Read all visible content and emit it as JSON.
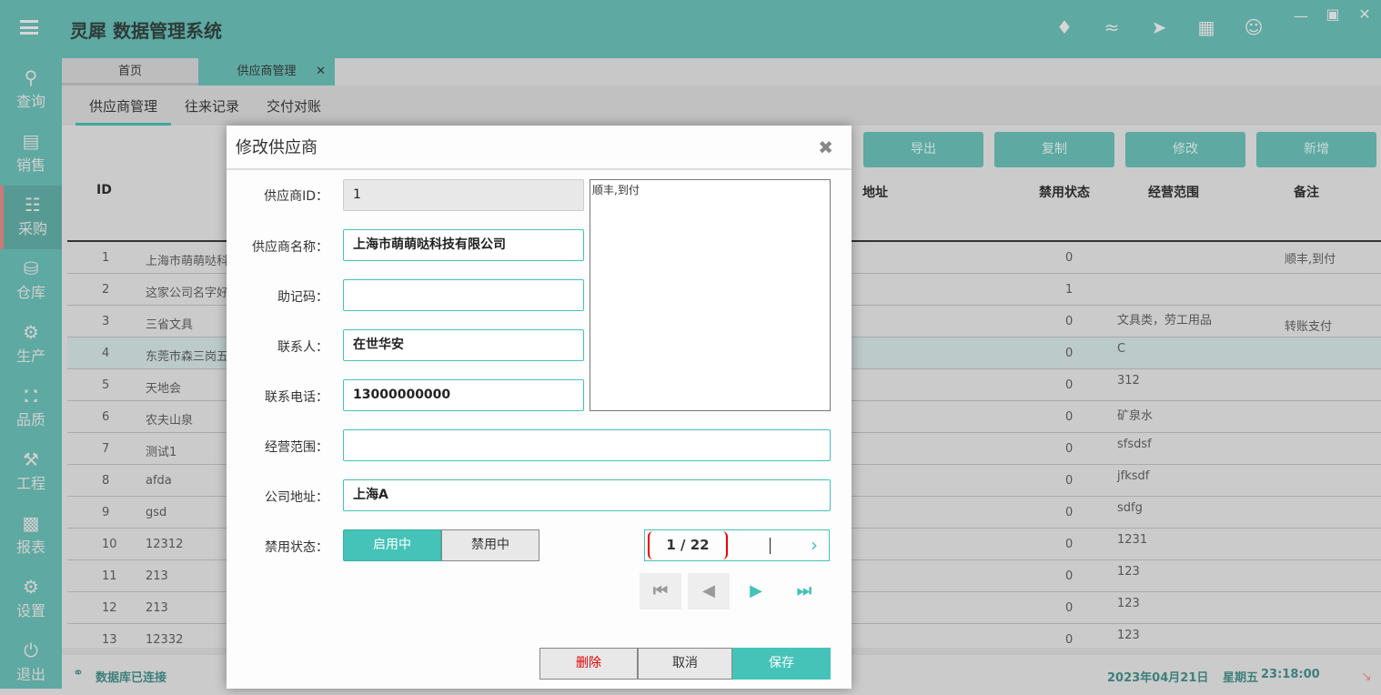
{
  "app": {
    "title": "灵犀 数据管理系统"
  },
  "header_icons": [
    "tag-icon",
    "wifi-icon",
    "send-icon",
    "calculator-icon",
    "user-icon",
    "minimize-icon",
    "maximize-icon",
    "close-icon"
  ],
  "sidebar": {
    "items": [
      {
        "label": "查询",
        "icon": "search-icon"
      },
      {
        "label": "销售",
        "icon": "document-icon"
      },
      {
        "label": "采购",
        "icon": "cart-icon",
        "active": true
      },
      {
        "label": "仓库",
        "icon": "database-icon"
      },
      {
        "label": "生产",
        "icon": "gears-icon"
      },
      {
        "label": "品质",
        "icon": "shield-icon"
      },
      {
        "label": "工程",
        "icon": "wrench-icon"
      },
      {
        "label": "报表",
        "icon": "bar-chart-icon"
      },
      {
        "label": "设置",
        "icon": "gear-icon"
      },
      {
        "label": "退出",
        "icon": "power-icon"
      }
    ]
  },
  "tabs": [
    {
      "label": "首页"
    },
    {
      "label": "供应商管理",
      "active": true
    }
  ],
  "subtabs": [
    {
      "label": "供应商管理"
    },
    {
      "label": "往来记录"
    },
    {
      "label": "交付对账"
    }
  ],
  "toolbar": {
    "export": "导出",
    "copy": "复制",
    "edit": "修改",
    "add": "新增"
  },
  "table": {
    "headers": {
      "id": "ID",
      "address": "地址",
      "status": "禁用状态",
      "scope": "经营范围",
      "remark": "备注"
    },
    "rows": [
      {
        "id": "1",
        "name": "上海市萌萌哒科",
        "status": "0",
        "scope": "",
        "remark": "顺丰,到付"
      },
      {
        "id": "2",
        "name": "这家公司名字好",
        "status": "1",
        "scope": "",
        "remark": ""
      },
      {
        "id": "3",
        "name": "三省文具",
        "status": "0",
        "scope": "文具类，劳工用品",
        "remark": "转账支付"
      },
      {
        "id": "4",
        "name": "东莞市森三岗五",
        "status": "0",
        "scope": "C",
        "remark": ""
      },
      {
        "id": "5",
        "name": "天地会",
        "status": "0",
        "scope": "312",
        "remark": ""
      },
      {
        "id": "6",
        "name": "农夫山泉",
        "status": "0",
        "scope": "矿泉水",
        "remark": ""
      },
      {
        "id": "7",
        "name": "测试1",
        "status": "0",
        "scope": "sfsdsf",
        "remark": ""
      },
      {
        "id": "8",
        "name": "afda",
        "status": "0",
        "scope": "jfksdf",
        "remark": ""
      },
      {
        "id": "9",
        "name": "gsd",
        "status": "0",
        "scope": "sdfg",
        "remark": ""
      },
      {
        "id": "10",
        "name": "12312",
        "status": "0",
        "scope": "1231",
        "remark": ""
      },
      {
        "id": "11",
        "name": "213",
        "status": "0",
        "scope": "123",
        "remark": ""
      },
      {
        "id": "12",
        "name": "213",
        "status": "0",
        "scope": "123",
        "remark": ""
      },
      {
        "id": "13",
        "name": "12332",
        "status": "0",
        "scope": "123",
        "remark": ""
      }
    ]
  },
  "footer": {
    "db_status": "数据库已连接",
    "date": "2023年04月21日",
    "weekday": "星期五",
    "time": "23:18:00"
  },
  "dialog": {
    "title": "修改供应商",
    "fields": {
      "id_label": "供应商ID：",
      "id": "1",
      "name_label": "供应商名称：",
      "name": "上海市萌萌哒科技有限公司",
      "code_label": "助记码：",
      "code": "",
      "contact_label": "联系人：",
      "contact": "在世华安",
      "phone_label": "联系电话：",
      "phone": "13000000000",
      "scope_label": "经营范围：",
      "scope": "",
      "address_label": "公司地址：",
      "address": "上海A",
      "status_label": "禁用状态："
    },
    "memo": "顺丰,到付",
    "status_on": "启用中",
    "status_off": "禁用中",
    "status_value": "启用中",
    "pager": "1 / 22",
    "delete": "删除",
    "cancel": "取消",
    "save": "保存"
  },
  "colors": {
    "accent": "#45c3b8",
    "header": "#5ea9a2",
    "delete_text": "#e00000"
  }
}
